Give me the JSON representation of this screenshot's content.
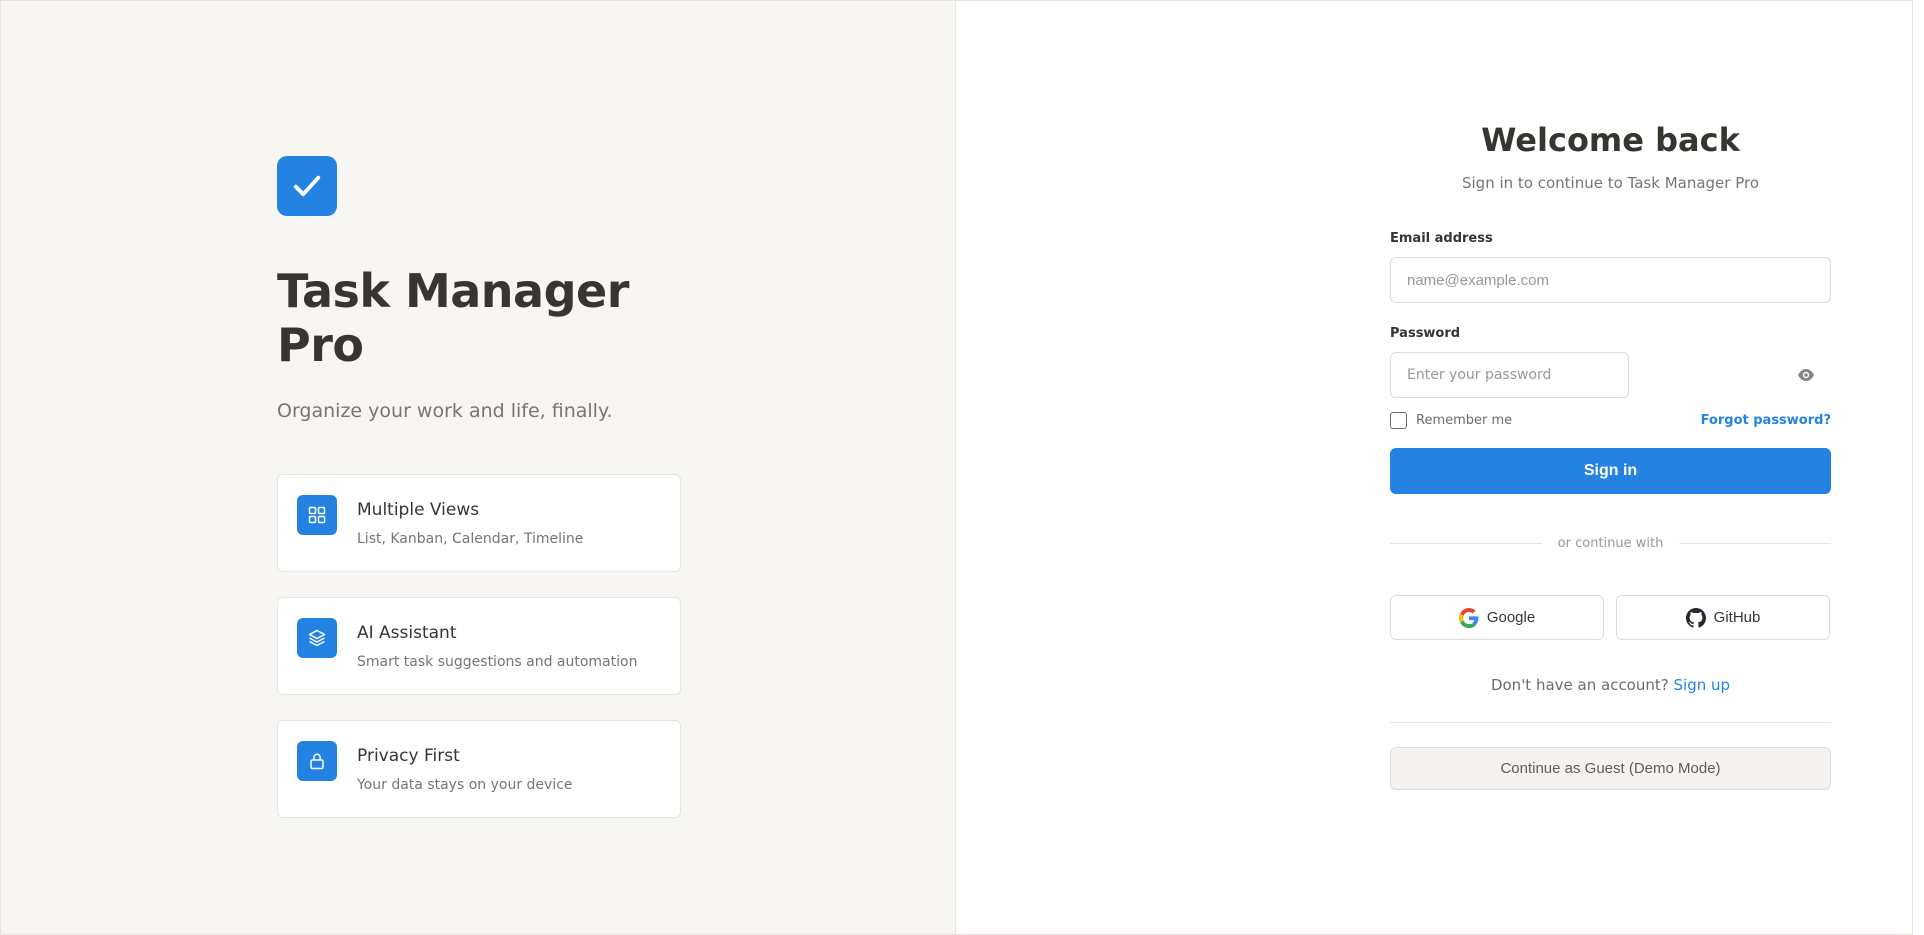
{
  "brand": {
    "logo_icon": "check-icon",
    "title": "Task Manager Pro",
    "tagline": "Organize your work and life, finally.",
    "accent": "#2483e2"
  },
  "features": [
    {
      "icon": "grid-icon",
      "title": "Multiple Views",
      "desc": "List, Kanban, Calendar, Timeline"
    },
    {
      "icon": "layers-icon",
      "title": "AI Assistant",
      "desc": "Smart task suggestions and automation"
    },
    {
      "icon": "lock-icon",
      "title": "Privacy First",
      "desc": "Your data stays on your device"
    }
  ],
  "login": {
    "heading": "Welcome back",
    "subheading": "Sign in to continue to Task Manager Pro",
    "email_label": "Email address",
    "email_placeholder": "name@example.com",
    "email_value": "",
    "password_label": "Password",
    "password_placeholder": "Enter your password",
    "password_value": "",
    "remember_label": "Remember me",
    "remember_checked": false,
    "forgot_label": "Forgot password?",
    "signin_label": "Sign in",
    "divider_text": "or continue with",
    "google_label": "Google",
    "github_label": "GitHub",
    "no_account_text": "Don't have an account?",
    "signup_label": "Sign up",
    "guest_label": "Continue as Guest (Demo Mode)"
  }
}
